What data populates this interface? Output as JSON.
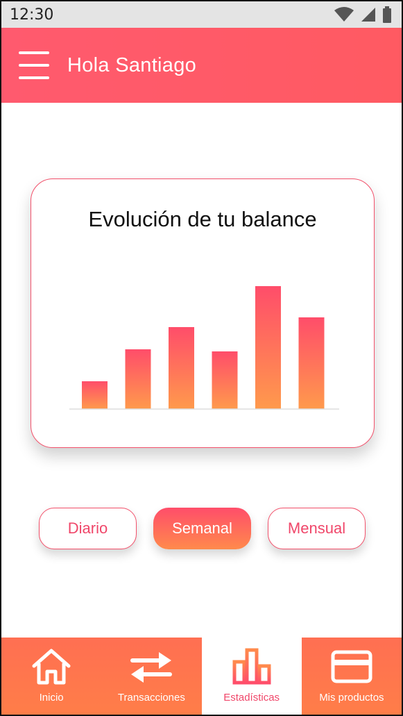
{
  "status_bar": {
    "time": "12:30",
    "icons": [
      "wifi-icon",
      "signal-icon",
      "battery-icon"
    ]
  },
  "app_bar": {
    "menu_icon": "hamburger-menu-icon",
    "greeting": "Hola Santiago"
  },
  "balance_card": {
    "title": "Evolución de tu balance",
    "chart_data": {
      "type": "bar",
      "categories": [
        "",
        "",
        "",
        "",
        "",
        ""
      ],
      "values": [
        40,
        86,
        118,
        83,
        177,
        132
      ],
      "ylim": [
        0,
        200
      ],
      "grid": false,
      "colors": {
        "top": "#ff4d6a",
        "bottom": "#ff9a4c"
      }
    }
  },
  "periods": {
    "items": [
      {
        "label": "Diario",
        "active": false
      },
      {
        "label": "Semanal",
        "active": true
      },
      {
        "label": "Mensual",
        "active": false
      }
    ]
  },
  "bottom_nav": {
    "items": [
      {
        "label": "Inicio",
        "icon": "home-icon",
        "active": false
      },
      {
        "label": "Transacciones",
        "icon": "swap-arrows-icon",
        "active": false
      },
      {
        "label": "Estadísticas",
        "icon": "bar-chart-icon",
        "active": true
      },
      {
        "label": "Mis productos",
        "icon": "credit-card-icon",
        "active": false
      }
    ]
  },
  "colors": {
    "brand": "#ff5a6e",
    "accent": "#f0476a",
    "nav_bg": "#ff7a4c"
  }
}
